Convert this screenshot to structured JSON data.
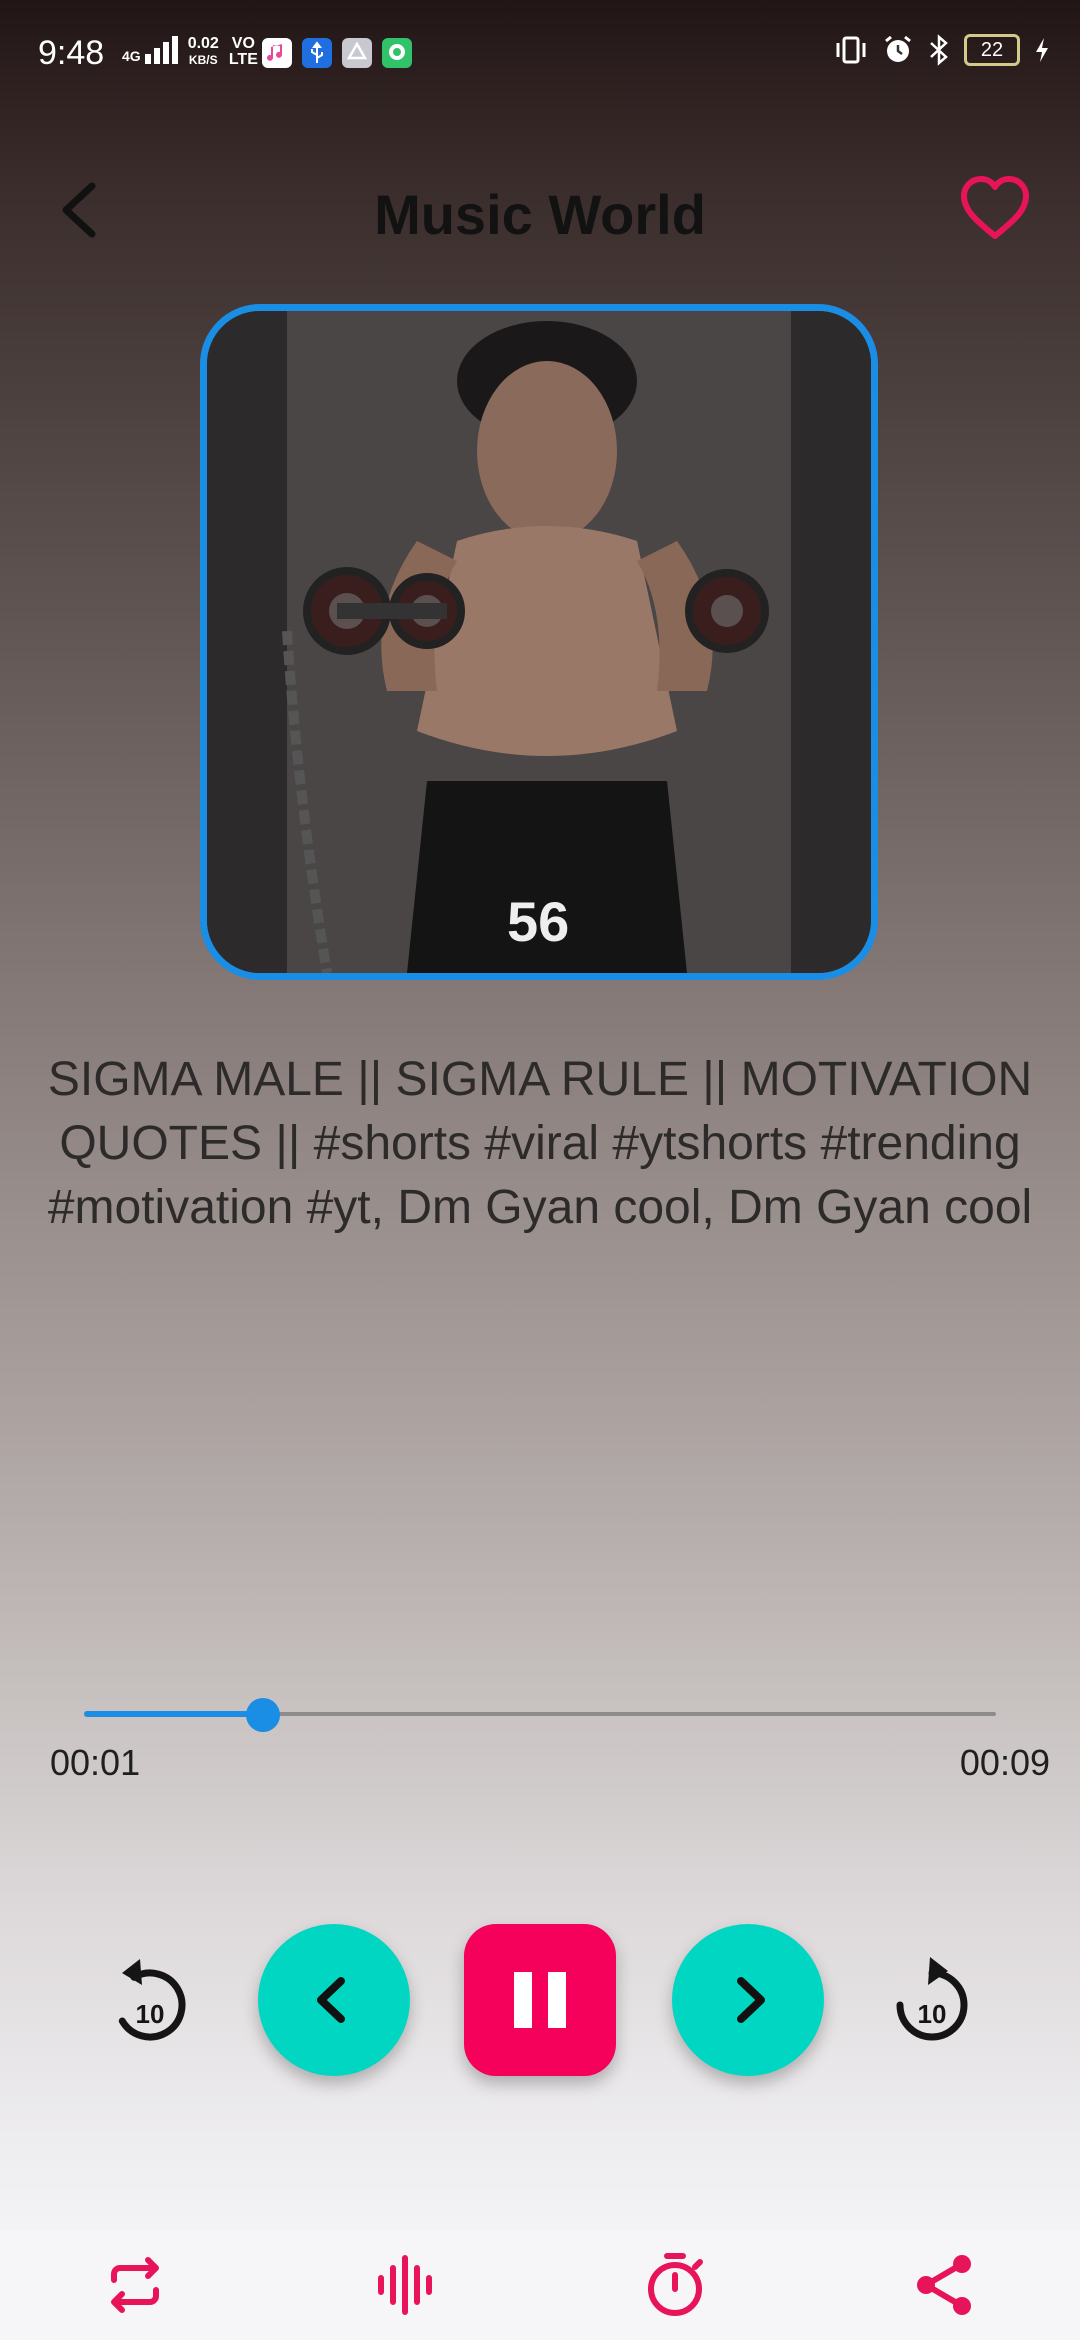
{
  "status_bar": {
    "time": "9:48",
    "network_type": "4G",
    "data_speed": "0.02",
    "data_speed_unit": "KB/S",
    "volte_top": "VO",
    "volte_bottom": "LTE",
    "battery_level": "22",
    "icons": [
      "vibrate-icon",
      "alarm-icon",
      "bluetooth-icon",
      "charging-icon"
    ]
  },
  "header": {
    "title": "Music World",
    "back_icon": "chevron-left-icon",
    "favorite_icon": "heart-outline-icon"
  },
  "player": {
    "song_title": "SIGMA MALE || SIGMA RULE || MOTIVATION QUOTES || #shorts #viral #ytshorts #trending #motivation #yt, Dm Gyan cool, Dm Gyan cool",
    "artwork_text": "56",
    "current_time": "00:01",
    "total_time": "00:09",
    "progress_fraction": 0.196,
    "rewind_label": "10",
    "forward_label": "10"
  },
  "colors": {
    "accent_blue": "#1a8de4",
    "teal": "#00d6c2",
    "pink": "#f5005a",
    "icon_pink": "#e8145a"
  },
  "bottom_bar": {
    "items": [
      "repeat-icon",
      "equalizer-icon",
      "timer-icon",
      "share-icon"
    ]
  }
}
